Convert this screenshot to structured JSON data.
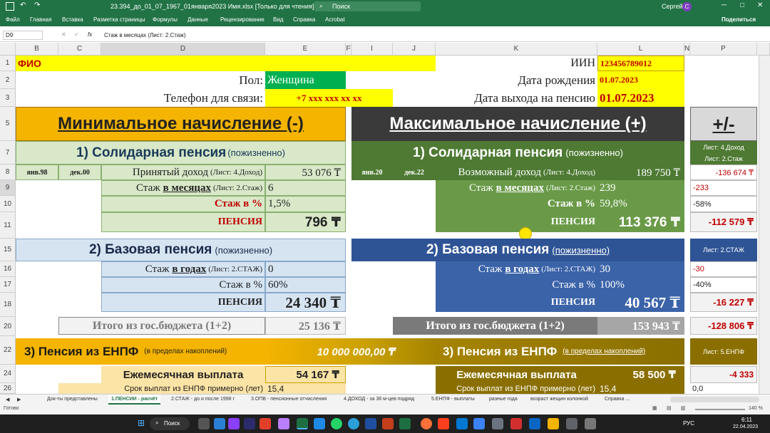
{
  "window": {
    "title": "23.394_до_01_07_1967_01января2023 Имя.xlsx [Только для чтения] - Excel",
    "search": "Поиск",
    "user": "Сергей",
    "user_initial": "С"
  },
  "menu": [
    "Файл",
    "Главная",
    "Вставка",
    "Разметка страницы",
    "Формулы",
    "Данные",
    "Рецензирование",
    "Вид",
    "Справка",
    "Acrobat"
  ],
  "share": "Поделиться",
  "formula": {
    "cell": "D9",
    "fx": "fx",
    "content": "Стаж в месяцах (Лист: 2.Стаж)"
  },
  "cols": [
    "B",
    "C",
    "D",
    "E",
    "F",
    "I",
    "J",
    "K",
    "L",
    "N",
    "P"
  ],
  "rows": [
    "1",
    "2",
    "3",
    "5",
    "7",
    "8",
    "9",
    "10",
    "11",
    "15",
    "16",
    "17",
    "18",
    "20",
    "22",
    "24",
    "26"
  ],
  "header": {
    "fio": "ФИО",
    "iin_label": "ИИН",
    "iin": "123456789012",
    "gender_label": "Пол:",
    "gender": "Женщина",
    "dob_label": "Дата рождения",
    "dob": "01.07.2023",
    "phone_label": "Телефон для связи:",
    "phone": "+7 xxx xxx xx xx",
    "retire_label": "Дата выхода на пенсию",
    "retire": "01.07.2023"
  },
  "min": {
    "title": "Минимальное начисление (-)",
    "sol_title": "1) Солидарная пенсия",
    "sol_sub": "(пожизненно)",
    "d1": "янв.98",
    "d2": "дек.00",
    "income_label": "Принятый доход",
    "income_note": "(Лист: 4.Доход)",
    "income": "53 076 ₸",
    "stazh_m_a": "Стаж",
    "stazh_m_b": "в месяцах",
    "stazh_m_c": "(Лист: 2.Стаж)",
    "stazh_m": "6",
    "stazh_pct_label": "Стаж в %",
    "stazh_pct": "1,5%",
    "pension_label": "ПЕНСИЯ",
    "pension": "796 ₸",
    "base_title": "2) Базовая пенсия",
    "base_sub": "(пожизненно)",
    "stazh_y_a": "Стаж",
    "stazh_y_b": "в годах",
    "stazh_y_c": "(Лист: 2.СТАЖ)",
    "stazh_y": "0",
    "base_pct_label": "Стаж в %",
    "base_pct": "60%",
    "base_pension_label": "ПЕНСИЯ",
    "base_pension": "24 340 ₸",
    "total_label": "Итого из гос.бюджета (1+2)",
    "total": "25 136 ₸",
    "enpf_title": "3) Пенсия из ЕНПФ",
    "enpf_sub": "(в пределах накоплений)",
    "enpf_amount": "10 000 000,00 ₸",
    "monthly_label": "Ежемесячная выплата",
    "monthly": "54 167 ₸",
    "term_label": "Срок выплат из ЕНПФ примерно (лет)",
    "term": "15,4"
  },
  "max": {
    "title": "Максимальное начисление (+)",
    "sol_title": "1) Солидарная пенсия",
    "sol_sub": "(пожизненно)",
    "d1": "янв.20",
    "d2": "дек.22",
    "income_label": "Возможный доход",
    "income_note": "(Лист: 4.Доход)",
    "income": "189 750 ₸",
    "stazh_m_a": "Стаж",
    "stazh_m_b": "в месяцах",
    "stazh_m_c": "(Лист: 2.Стаж)",
    "stazh_m": "239",
    "stazh_pct_label": "Стаж в %",
    "stazh_pct": "59,8%",
    "pension_label": "ПЕНСИЯ",
    "pension": "113 376 ₸",
    "base_title": "2) Базовая пенсия",
    "base_sub": "(пожизненно)",
    "stazh_y_a": "Стаж",
    "stazh_y_b": "в годах",
    "stazh_y_c": "(Лист: 2.СТАЖ)",
    "stazh_y": "30",
    "base_pct_label": "Стаж в %",
    "base_pct": "100%",
    "base_pension_label": "ПЕНСИЯ",
    "base_pension": "40 567 ₸",
    "total_label": "Итого из гос.бюджета (1+2)",
    "total": "153 943 ₸",
    "enpf_title": "3) Пенсия из ЕНПФ",
    "enpf_sub": "(в пределах накоплений)",
    "monthly_label": "Ежемесячная выплата",
    "monthly": "58 500 ₸",
    "term_label": "Срок выплат из ЕНПФ примерно (лет)",
    "term": "15,4"
  },
  "diff": {
    "title": "+/-",
    "note1": "Лист: 4.Доход",
    "note2": "Лист: 2.Стаж",
    "income": "-136 674 ₸",
    "stazh_m": "-233",
    "stazh_pct": "-58%",
    "pension": "-112 579 ₸",
    "note3": "Лист: 2.СТАЖ",
    "stazh_y": "-30",
    "base_pct": "-40%",
    "base_pension": "-16 227 ₸",
    "total": "-128 806 ₸",
    "note4": "Лист: 5.ЕНПФ",
    "monthly": "-4 333",
    "term": "0,0"
  },
  "sheets": [
    "Док-ты представлены",
    "1.ПЕНСИИ - расчёт",
    "2.СТАЖ - до и после 1998 г",
    "3.ОПВ - пенсионные отчисления",
    "4.ДОХОД - за 36 м-цев подряд",
    "5.ЕНПФ - выплаты",
    "разные года",
    "возраст жещин колонкой",
    "Справка ..."
  ],
  "status": {
    "ready": "Готово",
    "zoom": "140 %"
  },
  "taskbar": {
    "search": "Поиск",
    "lang": "РУС",
    "time": "6:11",
    "date": "22.04.2023"
  },
  "colors": {
    "excel_green": "#217346",
    "orange": "#f5b400",
    "dark": "#3a3a3a",
    "light_green": "#d8e8c8",
    "dark_green": "#4e7a33",
    "light_blue": "#d6e4f2",
    "dark_blue": "#2f5496",
    "gold": "#c9a000",
    "olive": "#8a6f00"
  }
}
